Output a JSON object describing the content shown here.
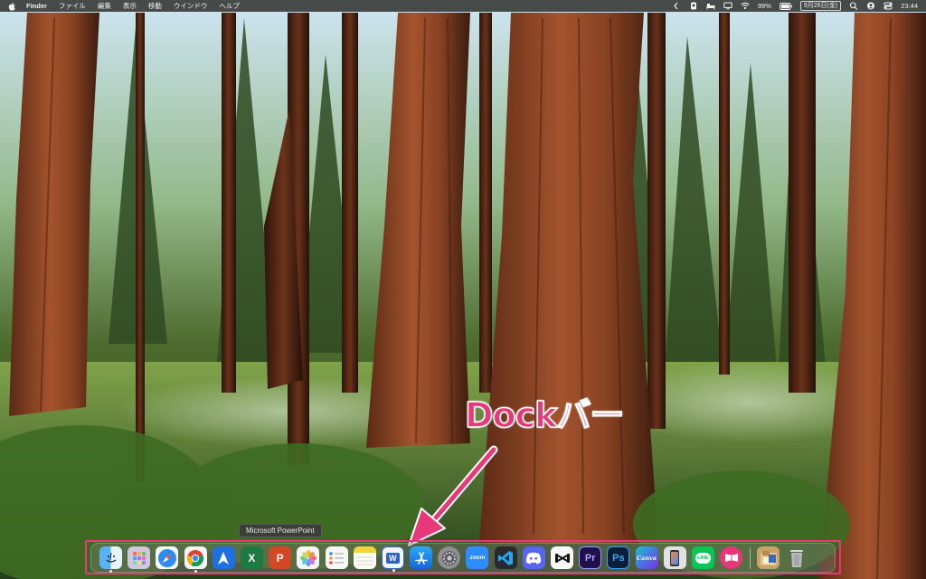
{
  "menubar": {
    "app_name": "Finder",
    "menus": [
      "ファイル",
      "編集",
      "表示",
      "移動",
      "ウインドウ",
      "ヘルプ"
    ],
    "status": {
      "battery": "99%",
      "date": "9月26日(金)",
      "time": "23:44"
    },
    "icons": [
      "chevron-left-icon",
      "shield-icon",
      "bed-icon",
      "monitor-icon",
      "wifi-icon",
      "battery-icon",
      "spotlight-icon",
      "user-icon",
      "control-center-icon"
    ]
  },
  "annotation": {
    "label": "Dockバー",
    "color": "#e8387a"
  },
  "tooltip": {
    "text": "Microsoft PowerPoint"
  },
  "dock": {
    "apps": [
      {
        "name": "finder",
        "glyph": "",
        "color": "#3e8ee8"
      },
      {
        "name": "launchpad",
        "glyph": "",
        "color": "#c9c2d8"
      },
      {
        "name": "safari",
        "glyph": "",
        "color": "#2d8cf0"
      },
      {
        "name": "chrome",
        "glyph": "",
        "color": "#f4f4f4"
      },
      {
        "name": "spark",
        "glyph": "",
        "color": "#2573e6"
      },
      {
        "name": "excel",
        "glyph": "X",
        "color": "#1d7a43"
      },
      {
        "name": "powerpoint",
        "glyph": "P",
        "color": "#d24726"
      },
      {
        "name": "photos",
        "glyph": "",
        "color": "#f5f5f5"
      },
      {
        "name": "reminders",
        "glyph": "",
        "color": "#f6f6f6"
      },
      {
        "name": "notes",
        "glyph": "",
        "color": "#f7f1c8"
      },
      {
        "name": "word",
        "glyph": "W",
        "color": "#2b64c4"
      },
      {
        "name": "app-store",
        "glyph": "A",
        "color": "#1c8cf0"
      },
      {
        "name": "system-settings",
        "glyph": "",
        "color": "#8e8e93"
      },
      {
        "name": "zoom",
        "glyph": "zoom",
        "color": "#2d8cff"
      },
      {
        "name": "vscode",
        "glyph": "",
        "color": "#2a2a2e"
      },
      {
        "name": "discord",
        "glyph": "",
        "color": "#5865f2"
      },
      {
        "name": "capcut",
        "glyph": "",
        "color": "#f4f4f4"
      },
      {
        "name": "premiere-pro",
        "glyph": "Pr",
        "color": "#1f0f4a"
      },
      {
        "name": "photoshop",
        "glyph": "Ps",
        "color": "#0b1e38"
      },
      {
        "name": "canva",
        "glyph": "Canva",
        "color": "#17b3c9"
      },
      {
        "name": "iphone-mirroring",
        "glyph": "",
        "color": "#dcdcdc"
      },
      {
        "name": "line",
        "glyph": "LINE",
        "color": "#06c755"
      },
      {
        "name": "kindle",
        "glyph": "",
        "color": "#e9367a"
      }
    ],
    "trailing": [
      {
        "name": "downloads",
        "glyph": "",
        "color": "#c9a36a"
      },
      {
        "name": "trash",
        "glyph": "",
        "color": "#9fa4a8"
      }
    ]
  }
}
